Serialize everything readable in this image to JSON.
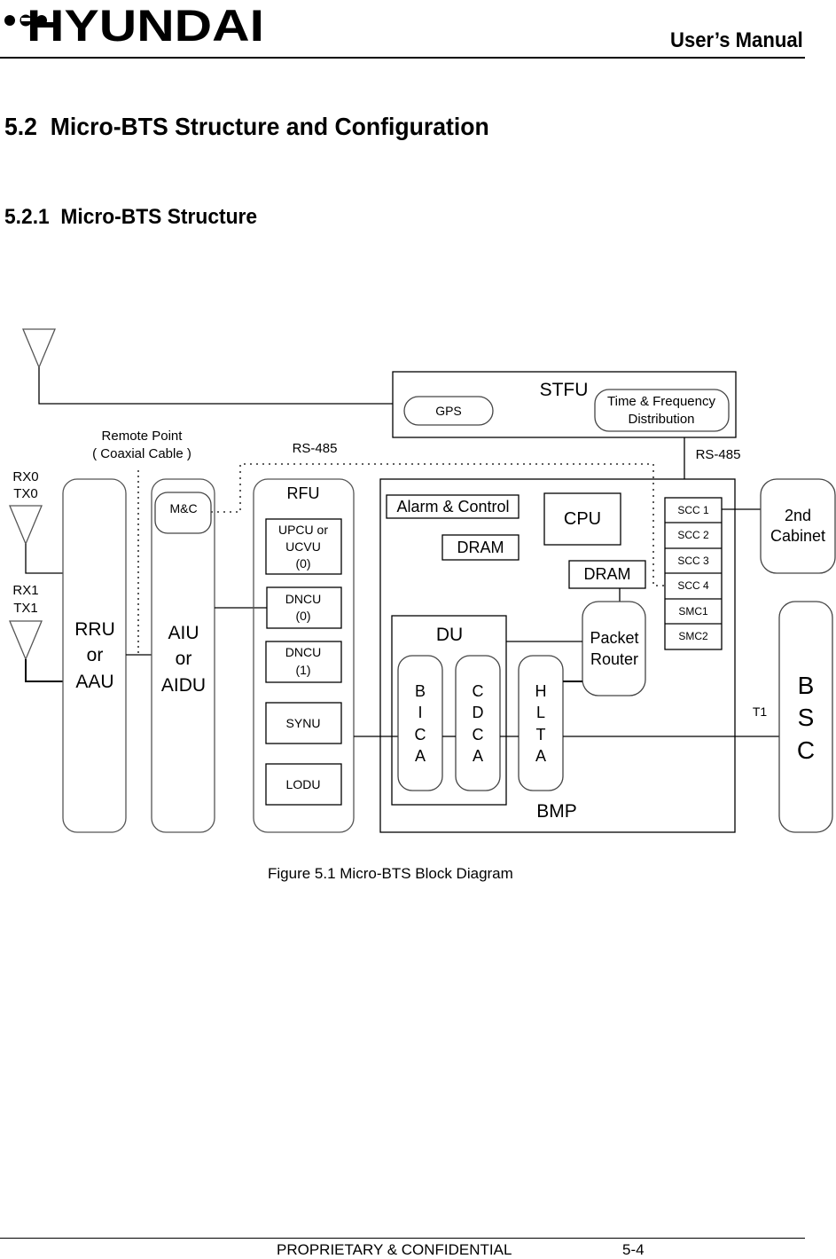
{
  "header": {
    "brand": "HYUNDAI",
    "title": "User’s Manual"
  },
  "section": {
    "heading": "5.2  Micro-BTS Structure and Configuration",
    "subheading": "5.2.1  Micro-BTS Structure"
  },
  "diagram": {
    "labels": {
      "remote_point_line1": "Remote Point",
      "remote_point_line2": "( Coaxial Cable )",
      "rs485_left": "RS-485",
      "rs485_right": "RS-485",
      "rx0": "RX0",
      "tx0": "TX0",
      "rx1": "RX1",
      "tx1": "TX1",
      "t1": "T1"
    },
    "stfu": {
      "title": "STFU",
      "gps": "GPS",
      "tfd_line1": "Time & Frequency",
      "tfd_line2": "Distribution"
    },
    "rru": [
      "RRU",
      "or",
      "AAU"
    ],
    "aiu": {
      "lines": [
        "AIU",
        "or",
        "AIDU"
      ],
      "mc": "M&C"
    },
    "rfu": {
      "title": "RFU",
      "upcu": [
        "UPCU or",
        "UCVU",
        "(0)"
      ],
      "dncu0": [
        "DNCU",
        "(0)"
      ],
      "dncu1": [
        "DNCU",
        "(1)"
      ],
      "synu": "SYNU",
      "lodu": "LODU"
    },
    "bmp": {
      "title": "BMP",
      "alarm_control": "Alarm & Control",
      "cpu": "CPU",
      "dram1": "DRAM",
      "dram2": "DRAM",
      "du": "DU",
      "bica": [
        "B",
        "I",
        "C",
        "A"
      ],
      "cdca": [
        "C",
        "D",
        "C",
        "A"
      ],
      "hlta": [
        "H",
        "L",
        "T",
        "A"
      ],
      "packet_router": [
        "Packet",
        "Router"
      ],
      "ports": [
        "SCC 1",
        "SCC 2",
        "SCC 3",
        "SCC 4",
        "SMC1",
        "SMC2"
      ]
    },
    "second_cabinet": [
      "2nd",
      "Cabinet"
    ],
    "bsc": [
      "B",
      "S",
      "C"
    ]
  },
  "caption": "Figure 5.1 Micro-BTS Block Diagram",
  "footer": {
    "text": "PROPRIETARY & CONFIDENTIAL",
    "page": "5-4"
  }
}
